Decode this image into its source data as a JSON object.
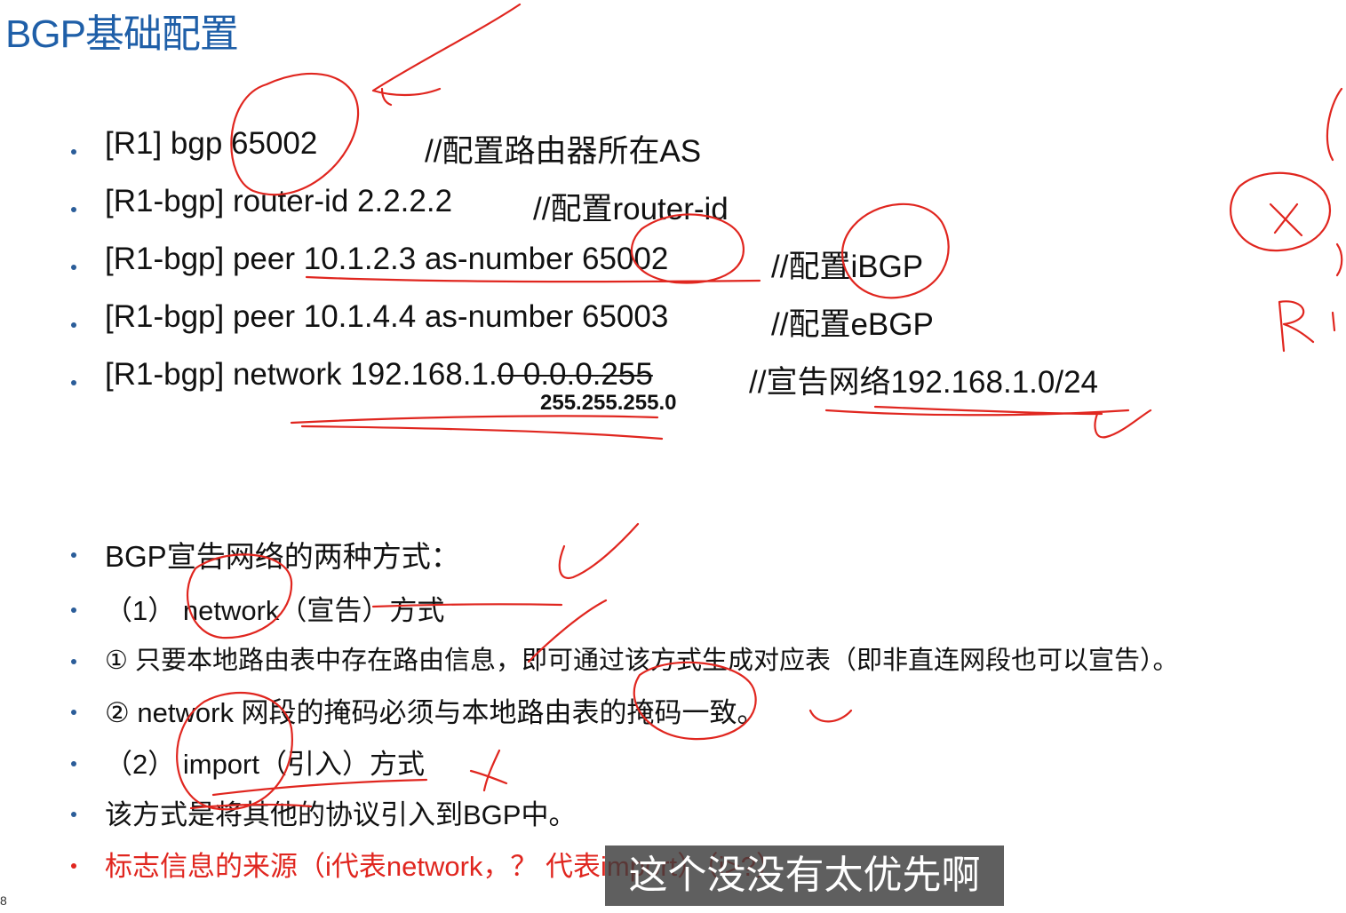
{
  "slide": {
    "title": "BGP基础配置",
    "config_lines": [
      {
        "cmd": "[R1] bgp 65002",
        "comment": "//配置路由器所在AS"
      },
      {
        "cmd": "[R1-bgp] router-id 2.2.2.2",
        "comment": "//配置router-id"
      },
      {
        "cmd": "[R1-bgp] peer 10.1.2.3 as-number 65002",
        "comment": "//配置iBGP"
      },
      {
        "cmd": "[R1-bgp] peer 10.1.4.4 as-number 65003",
        "comment": "//配置eBGP"
      },
      {
        "cmd_prefix": "[R1-bgp] network 192.168.1.",
        "cmd_struck": "0 0.0.0.255",
        "comment": "//宣告网络192.168.1.0/24"
      }
    ],
    "mask_annotation": "255.255.255.0",
    "methods": [
      "BGP宣告网络的两种方式：",
      "（1） network（宣告）方式",
      "① 只要本地路由表中存在路由信息，即可通过该方式生成对应表（即非直连网段也可以宣告）。",
      "② network 网段的掩码必须与本地路由表的掩码一致。",
      "（2） import（引入）方式",
      " 该方式是将其他的协议引入到BGP中。",
      "标志信息的来源（i代表network，？ 代表import）（i>?）"
    ],
    "slide_number": "8"
  },
  "video_subtitle": "这个没没有太优先啊",
  "colors": {
    "title": "#1f5fa8",
    "bullet": "#2b5d99",
    "highlight_text": "#e0261f",
    "ink": "#e0261f"
  }
}
